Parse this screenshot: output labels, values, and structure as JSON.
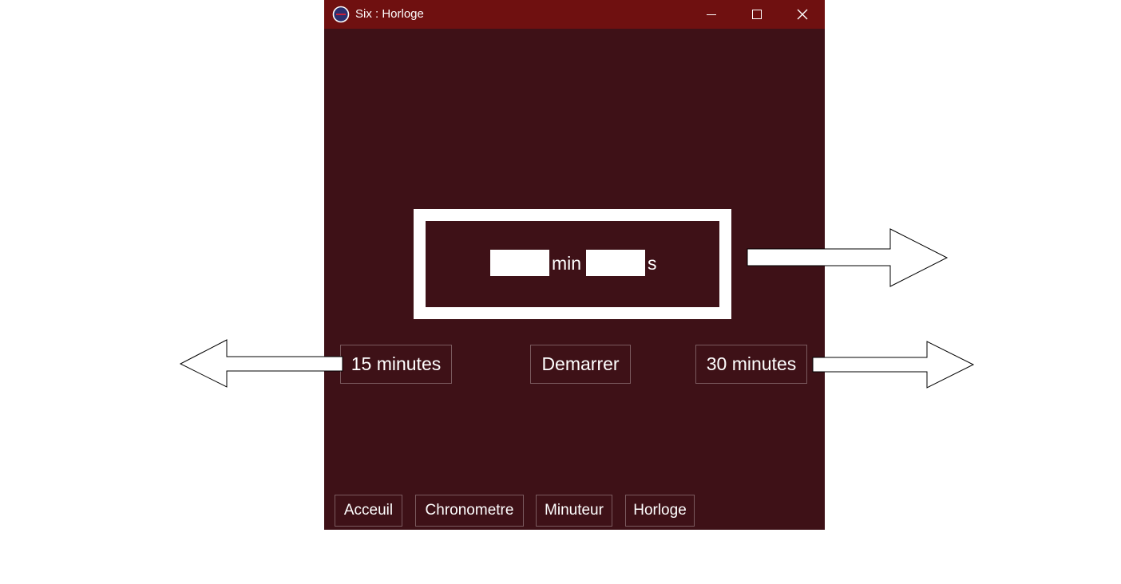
{
  "window": {
    "title": "Six : Horloge",
    "titlebar_color": "#6f1010",
    "background_color": "#3e1117",
    "controls": {
      "minimize_icon": "minimize-icon",
      "maximize_icon": "maximize-icon",
      "close_icon": "close-icon"
    }
  },
  "timer": {
    "minutes_value": "",
    "seconds_value": "",
    "minutes_unit": "min",
    "seconds_unit": "s"
  },
  "actions": {
    "preset_15_label": "15 minutes",
    "start_label": "Demarrer",
    "preset_30_label": "30 minutes"
  },
  "nav": {
    "items": [
      {
        "label": "Acceuil"
      },
      {
        "label": "Chronometre"
      },
      {
        "label": "Minuteur"
      },
      {
        "label": "Horloge"
      }
    ]
  },
  "annotations": {
    "arrow_icon": "arrow-icon"
  }
}
